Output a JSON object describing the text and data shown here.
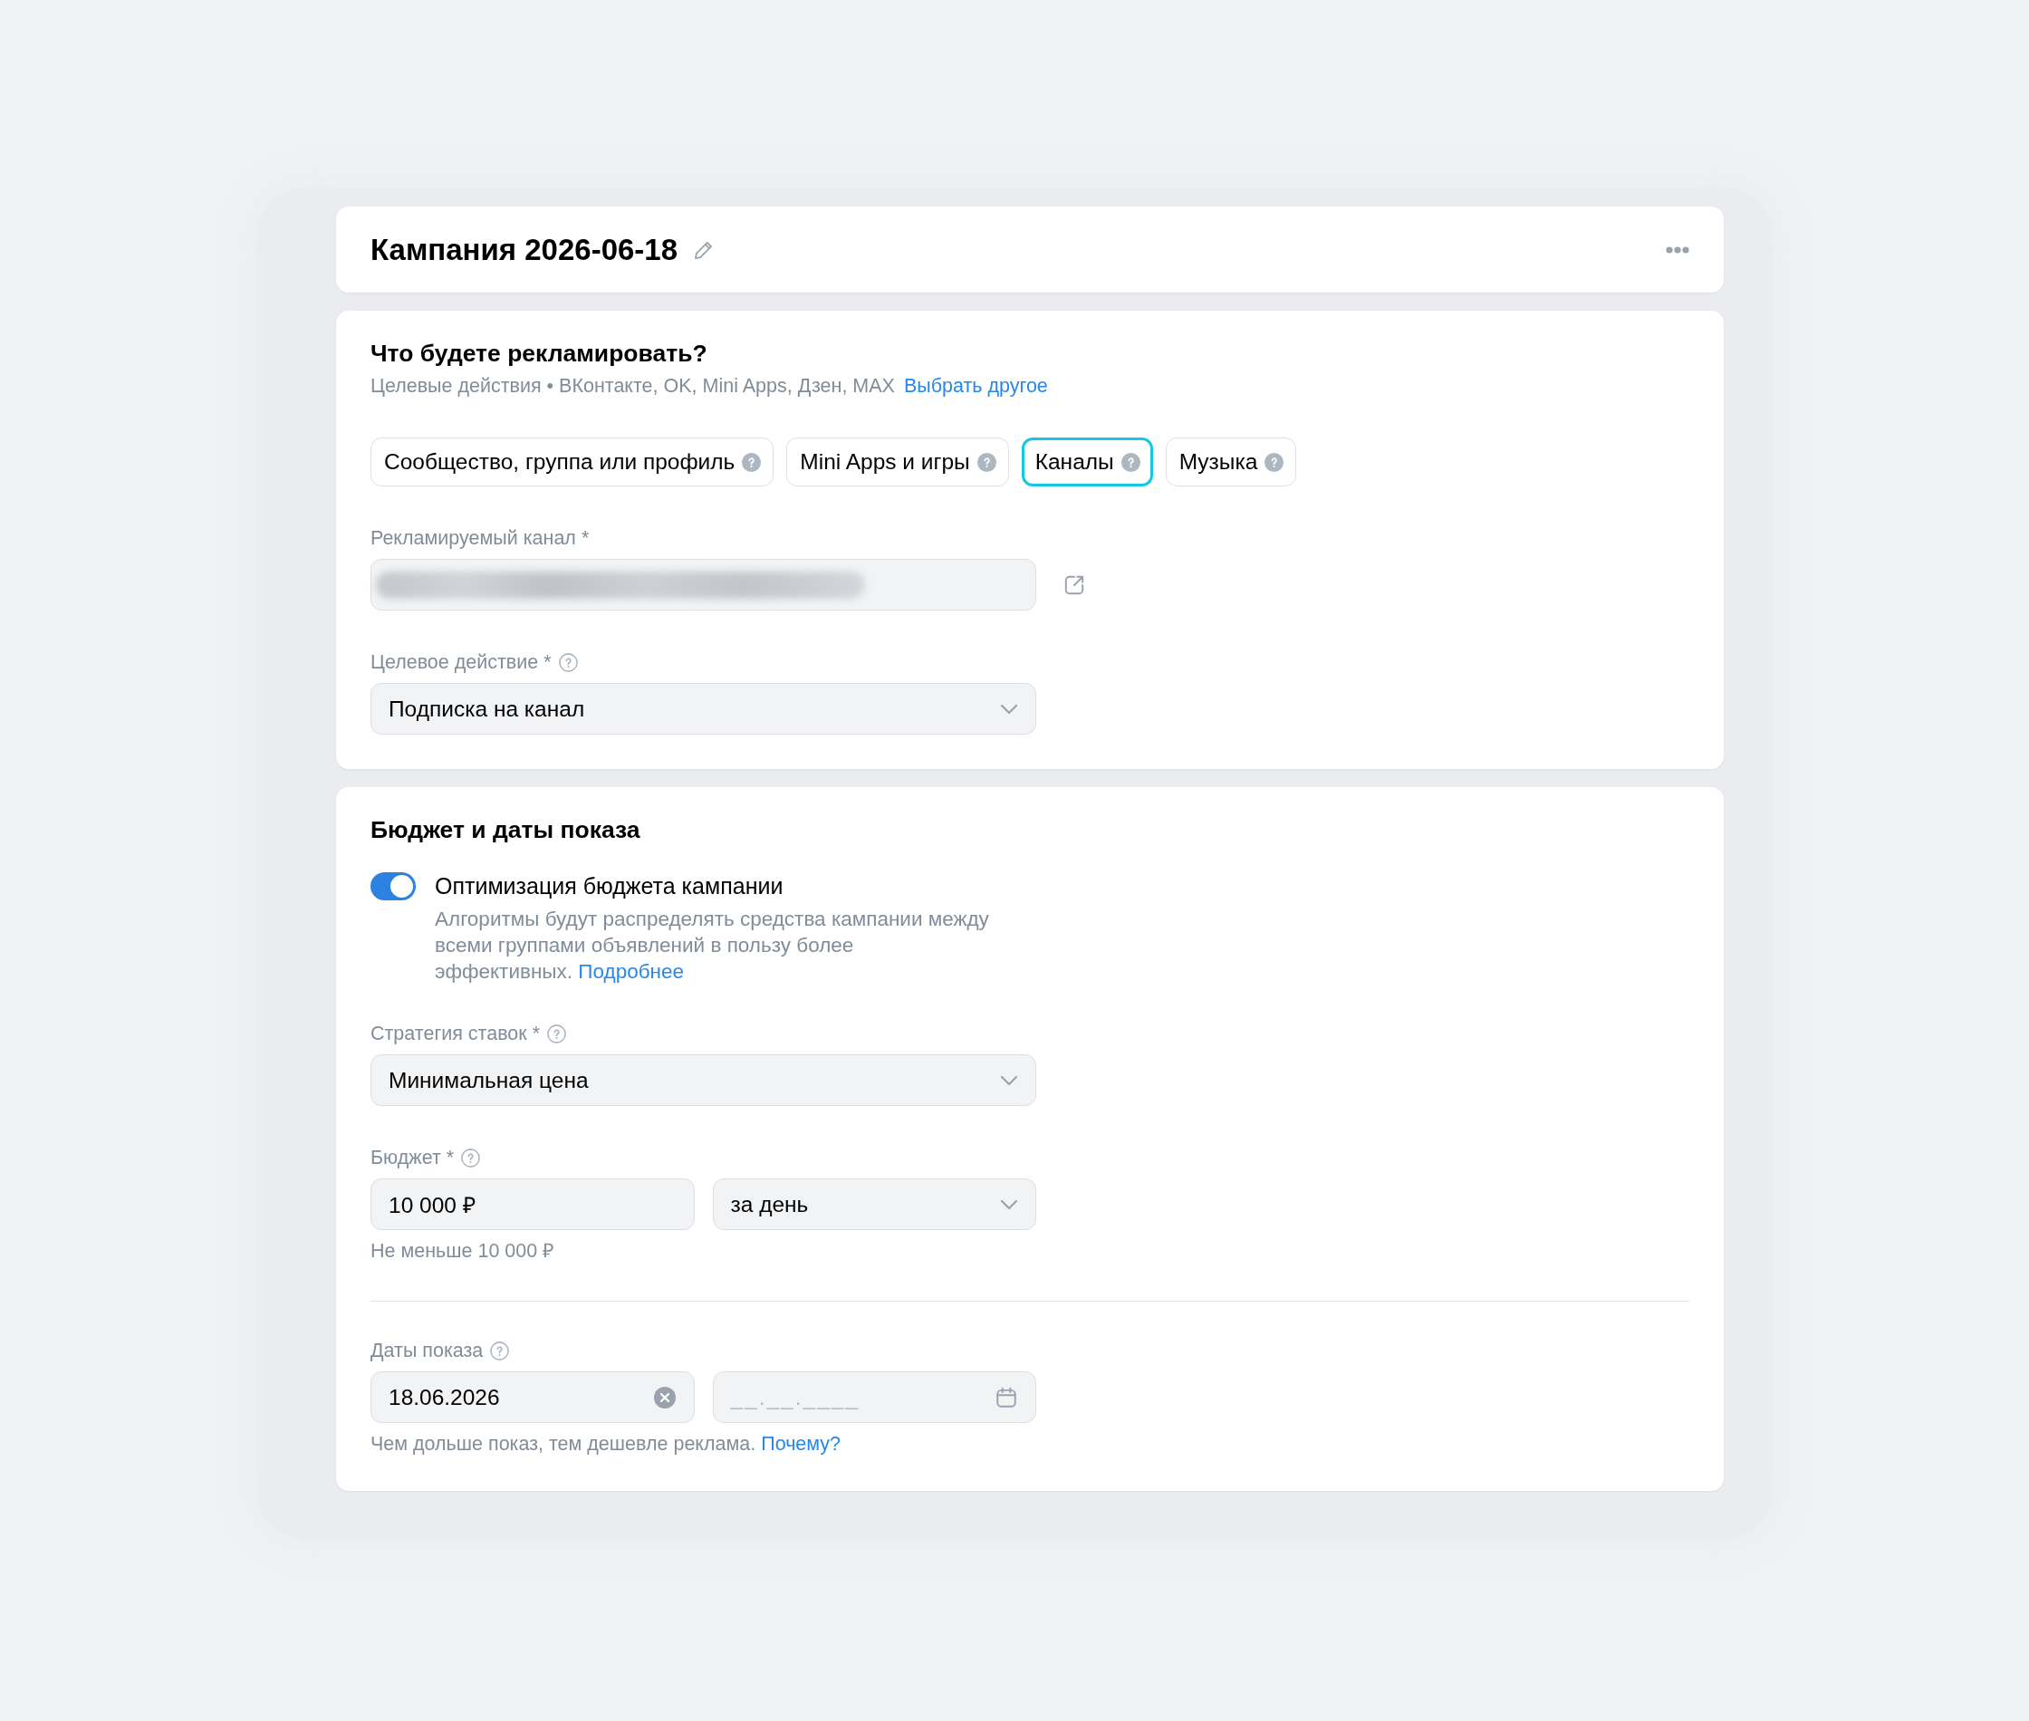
{
  "header": {
    "title": "Кампания 2026-06-18"
  },
  "promote": {
    "title": "Что будете рекламировать?",
    "subtitle": "Целевые действия • ВКонтакте, OK, Mini Apps, Дзен, MAX",
    "subtitle_link": "Выбрать другое",
    "options": [
      {
        "label": "Сообщество, группа или профиль",
        "selected": false
      },
      {
        "label": "Mini Apps и игры",
        "selected": false
      },
      {
        "label": "Каналы",
        "selected": true
      },
      {
        "label": "Музыка",
        "selected": false
      }
    ],
    "fields": [
      {
        "kind": "link",
        "label": "Рекламируемый канал *",
        "help": false,
        "redacted": true
      },
      {
        "kind": "select",
        "label": "Целевое действие *",
        "help": true,
        "value": "Подписка на канал"
      }
    ]
  },
  "budget": {
    "title": "Бюджет и даты показа",
    "toggle": {
      "label": "Оптимизация бюджета кампании",
      "on": true,
      "description": "Алгоритмы будут распределять средства кампании между всеми группами объявлений в пользу более эффективных.",
      "link": "Подробнее"
    },
    "fields": [
      {
        "kind": "select",
        "label": "Стратегия ставок *",
        "help": true,
        "value": "Минимальная цена"
      },
      {
        "kind": "pair",
        "label": "Бюджет *",
        "help": true,
        "inputs": [
          {
            "kind": "text",
            "value": "10 000 ₽"
          },
          {
            "kind": "select",
            "value": "за день"
          }
        ],
        "hint": "Не меньше 10 000 ₽"
      },
      {
        "kind": "pair",
        "label": "Даты показа",
        "help": true,
        "divider_before": true,
        "inputs": [
          {
            "kind": "date",
            "value": "18.06.2026"
          },
          {
            "kind": "date",
            "placeholder": "__.__.____"
          }
        ],
        "hint": "Чем дольше показ, тем дешевле реклама.",
        "hint_link": "Почему?"
      }
    ]
  }
}
